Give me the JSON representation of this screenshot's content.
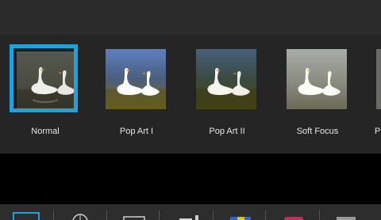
{
  "colors": {
    "accent": "#1ba3e0",
    "strip_background": "#252525",
    "top_bar": "#2b2b2b",
    "bottom_bar": "#2d2d2d"
  },
  "filters": [
    {
      "label": "Normal",
      "selected": true
    },
    {
      "label": "Pop Art I",
      "selected": false
    },
    {
      "label": "Pop Art II",
      "selected": false
    },
    {
      "label": "Soft Focus",
      "selected": false
    },
    {
      "label": "P",
      "selected": false
    }
  ],
  "toolbar": {
    "icons": [
      "crop-icon",
      "globe-icon",
      "frame-icon",
      "adjust-icon",
      "color-icon",
      "effect-icon",
      "overlay-icon"
    ]
  }
}
